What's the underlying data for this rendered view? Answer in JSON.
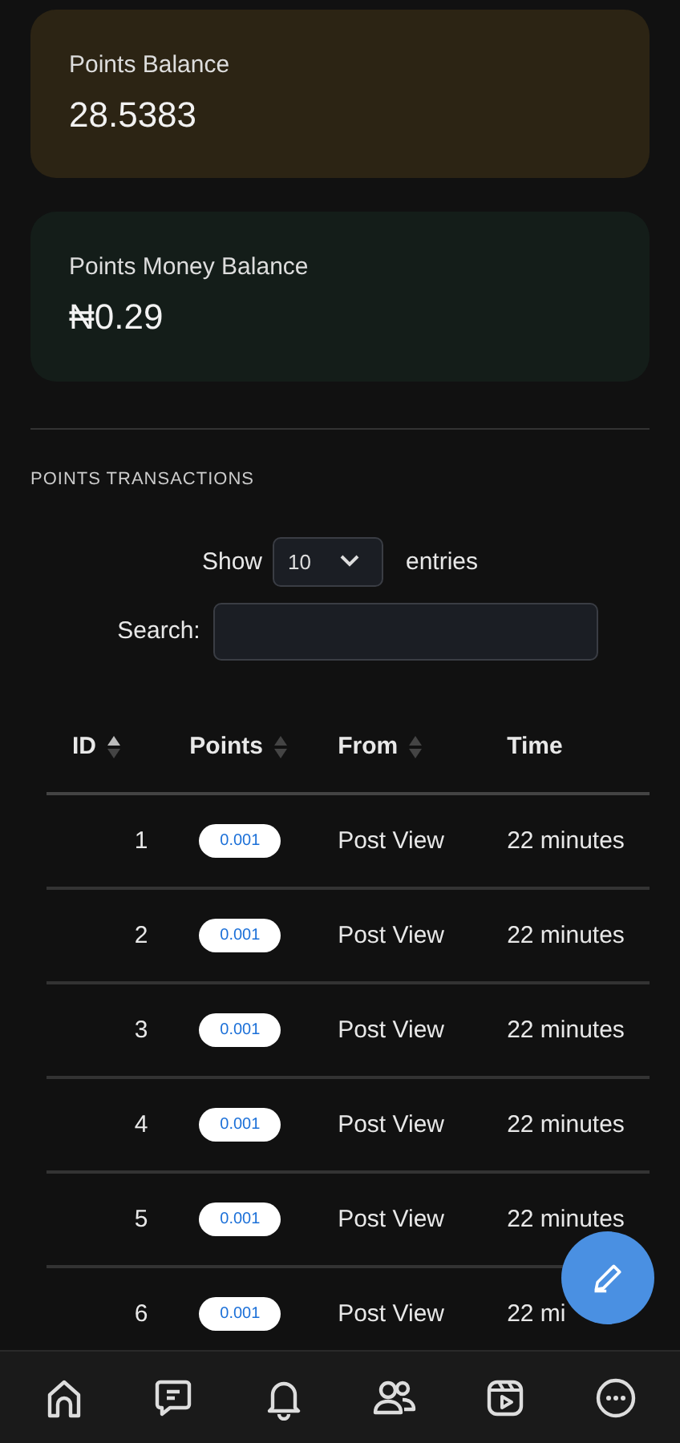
{
  "balances": [
    {
      "label": "Points Balance",
      "value": "28.5383",
      "color": "#2c2414"
    },
    {
      "label": "Points Money Balance",
      "value": "₦0.29",
      "color": "#141d19"
    }
  ],
  "transactions": {
    "title": "POINTS TRANSACTIONS",
    "show_label": "Show",
    "page_size": "10",
    "entries_label": "entries",
    "search_label": "Search:",
    "columns": [
      {
        "label": "ID",
        "sorted": true
      },
      {
        "label": "Points",
        "sorted": false
      },
      {
        "label": "From",
        "sorted": false
      },
      {
        "label": "Time"
      }
    ],
    "rows": [
      {
        "id": "1",
        "points": "0.001",
        "from": "Post View",
        "time": "22 minutes"
      },
      {
        "id": "2",
        "points": "0.001",
        "from": "Post View",
        "time": "22 minutes"
      },
      {
        "id": "3",
        "points": "0.001",
        "from": "Post View",
        "time": "22 minutes"
      },
      {
        "id": "4",
        "points": "0.001",
        "from": "Post View",
        "time": "22 minutes"
      },
      {
        "id": "5",
        "points": "0.001",
        "from": "Post View",
        "time": "22 minutes"
      },
      {
        "id": "6",
        "points": "0.001",
        "from": "Post View",
        "time": "22 mi"
      }
    ]
  },
  "bottom_nav": [
    {
      "kind": "home"
    },
    {
      "kind": "chat"
    },
    {
      "kind": "bell"
    },
    {
      "kind": "people"
    },
    {
      "kind": "video"
    },
    {
      "kind": "more"
    }
  ]
}
